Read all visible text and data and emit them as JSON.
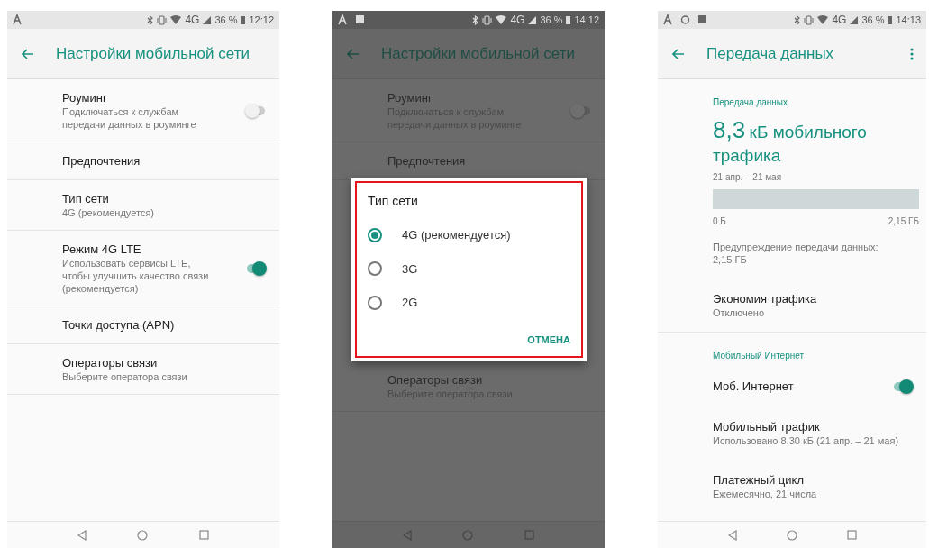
{
  "phones": [
    {
      "dimmed": false,
      "status_bar": {
        "network": "4G",
        "battery": "36 %",
        "time": "12:12"
      },
      "app_bar": {
        "title": "Настройки мобильной сети",
        "overflow_menu": false
      },
      "items": [
        {
          "kind": "toggle",
          "title": "Роуминг",
          "subtitle": "Подключаться к службам передачи данных в роуминге",
          "on": false
        },
        {
          "kind": "text",
          "title": "Предпочтения"
        },
        {
          "kind": "text",
          "title": "Тип сети",
          "subtitle": "4G (рекомендуется)"
        },
        {
          "kind": "toggle",
          "title": "Режим 4G LTE",
          "subtitle": "Использовать сервисы LTE, чтобы улучшить качество связи (рекомендуется)",
          "on": true
        },
        {
          "kind": "text",
          "title": "Точки доступа (APN)"
        },
        {
          "kind": "text",
          "title": "Операторы связи",
          "subtitle": "Выберите оператора связи"
        }
      ]
    },
    {
      "dimmed": true,
      "status_bar": {
        "network": "4G",
        "battery": "36 %",
        "time": "14:12"
      },
      "app_bar": {
        "title": "Настройки мобильной сети",
        "overflow_menu": false
      },
      "items": [
        {
          "kind": "toggle",
          "title": "Роуминг",
          "subtitle": "Подключаться к службам передачи данных в роуминге",
          "on": false
        },
        {
          "kind": "text",
          "title": "Предпочтения"
        }
      ],
      "dialog": {
        "title": "Тип сети",
        "highlighted": true,
        "options": [
          {
            "label": "4G (рекомендуется)",
            "selected": true
          },
          {
            "label": "3G",
            "selected": false
          },
          {
            "label": "2G",
            "selected": false
          }
        ],
        "button": "ОТМЕНА"
      },
      "items_below": [
        {
          "kind": "text",
          "title": "Операторы связи",
          "subtitle": "Выберите оператора связи"
        }
      ]
    },
    {
      "dimmed": false,
      "status_bar": {
        "network": "4G",
        "battery": "36 %",
        "time": "14:13"
      },
      "app_bar": {
        "title": "Передача данных",
        "overflow_menu": true
      },
      "items": [
        {
          "kind": "header",
          "title": "Передача данных"
        },
        {
          "kind": "usage",
          "amount": "8,3",
          "unit": "кБ мобильного трафика",
          "period": "21 апр. – 21 мая",
          "level": 0,
          "min_label": "0 Б",
          "max_label": "2,15 ГБ"
        },
        {
          "kind": "note",
          "title": "Предупреждение передачи данных: 2,15 ГБ"
        },
        {
          "kind": "text",
          "title": "Экономия трафика",
          "subtitle": "Отключено"
        },
        {
          "kind": "header",
          "title": "Мобильный Интернет"
        },
        {
          "kind": "toggle",
          "title": "Моб. Интернет",
          "on": true
        },
        {
          "kind": "text",
          "title": "Мобильный трафик",
          "subtitle": "Использовано 8,30 кБ (21 апр. – 21 мая)"
        },
        {
          "kind": "text",
          "title": "Платежный цикл",
          "subtitle": "Ежемесячно, 21 числа"
        }
      ]
    }
  ]
}
